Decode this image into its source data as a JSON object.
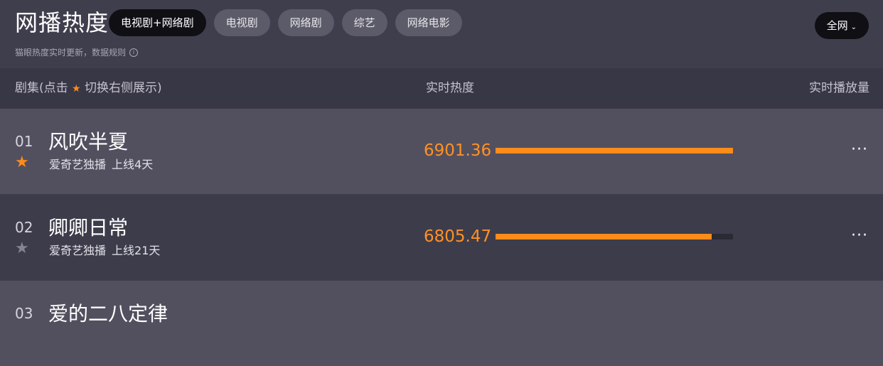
{
  "header": {
    "title": "网播热度",
    "subtitle": "猫眼热度实时更新，数据规则",
    "info_icon": "info-icon",
    "tabs": [
      {
        "label": "电视剧+网络剧",
        "active": true
      },
      {
        "label": "电视剧",
        "active": false
      },
      {
        "label": "网络剧",
        "active": false
      },
      {
        "label": "综艺",
        "active": false
      },
      {
        "label": "网络电影",
        "active": false
      }
    ],
    "scope_label": "全网",
    "scope_icon": "chevron-down-icon"
  },
  "columns": {
    "series_prefix": "剧集(点击",
    "series_suffix": "切换右侧展示)",
    "heat": "实时热度",
    "plays": "实时播放量"
  },
  "rows": [
    {
      "rank": "01",
      "name": "风吹半夏",
      "platform": "爱奇艺独播",
      "online": "上线4天",
      "heat": "6901.36",
      "heat_fraction": 1.0,
      "starred": true
    },
    {
      "rank": "02",
      "name": "卿卿日常",
      "platform": "爱奇艺独播",
      "online": "上线21天",
      "heat": "6805.47",
      "heat_fraction": 0.91,
      "starred": false
    },
    {
      "rank": "03",
      "name": "爱的二八定律"
    }
  ],
  "icons": {
    "star": "star-icon",
    "more": "more-icon"
  },
  "colors": {
    "accent": "#ff8c1a",
    "background": "#3f3e4d",
    "row_highlight": "#52505f",
    "active_tab": "#0f0f14"
  }
}
